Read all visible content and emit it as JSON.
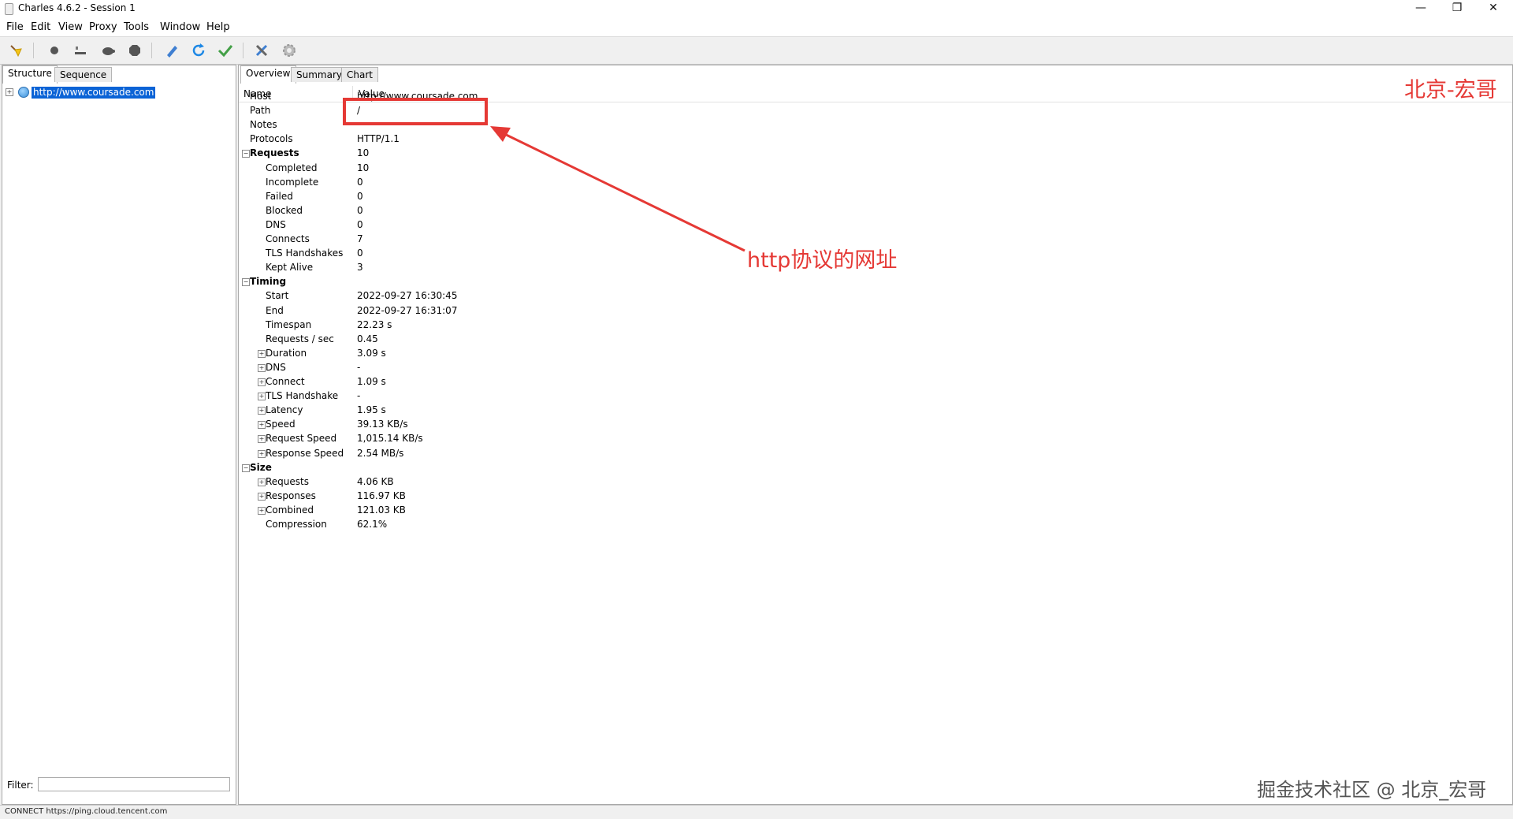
{
  "window": {
    "title": "Charles 4.6.2 - Session 1",
    "controls": [
      "—",
      "❐",
      "✕"
    ]
  },
  "menu": [
    "File",
    "Edit",
    "View",
    "Proxy",
    "Tools",
    "Window",
    "Help"
  ],
  "toolbar": {
    "icons": [
      "broom-icon",
      "record-icon",
      "throttle-icon",
      "turtle-icon",
      "stop-icon",
      "pen-icon",
      "refresh-icon",
      "check-icon",
      "tools-icon",
      "settings-icon"
    ]
  },
  "left": {
    "tabs": [
      "Structure",
      "Sequence"
    ],
    "tree": {
      "expander": "+",
      "host": "http://www.coursade.com"
    },
    "filter_label": "Filter:",
    "filter_value": ""
  },
  "right": {
    "tabs": [
      "Overview",
      "Summary",
      "Chart"
    ],
    "columns": {
      "name": "Name",
      "value": "Value"
    },
    "rows": [
      {
        "name": "Host",
        "value": "http://www.coursade.com"
      },
      {
        "name": "Path",
        "value": "/"
      },
      {
        "name": "Notes",
        "value": ""
      },
      {
        "name": "Protocols",
        "value": "HTTP/1.1"
      },
      {
        "name": "Requests",
        "value": "10"
      },
      {
        "name": "Completed",
        "value": "10"
      },
      {
        "name": "Incomplete",
        "value": "0"
      },
      {
        "name": "Failed",
        "value": "0"
      },
      {
        "name": "Blocked",
        "value": "0"
      },
      {
        "name": "DNS",
        "value": "0"
      },
      {
        "name": "Connects",
        "value": "7"
      },
      {
        "name": "TLS Handshakes",
        "value": "0"
      },
      {
        "name": "Kept Alive",
        "value": "3"
      },
      {
        "name": "Timing",
        "value": ""
      },
      {
        "name": "Start",
        "value": "2022-09-27 16:30:45"
      },
      {
        "name": "End",
        "value": "2022-09-27 16:31:07"
      },
      {
        "name": "Timespan",
        "value": "22.23 s"
      },
      {
        "name": "Requests / sec",
        "value": "0.45"
      },
      {
        "name": "Duration",
        "value": "3.09 s"
      },
      {
        "name": "DNS",
        "value": "-"
      },
      {
        "name": "Connect",
        "value": "1.09 s"
      },
      {
        "name": "TLS Handshake",
        "value": "-"
      },
      {
        "name": "Latency",
        "value": "1.95 s"
      },
      {
        "name": "Speed",
        "value": "39.13 KB/s"
      },
      {
        "name": "Request Speed",
        "value": "1,015.14 KB/s"
      },
      {
        "name": "Response Speed",
        "value": "2.54 MB/s"
      },
      {
        "name": "Size",
        "value": ""
      },
      {
        "name": "Requests",
        "value": "4.06 KB"
      },
      {
        "name": "Responses",
        "value": "116.97 KB"
      },
      {
        "name": "Combined",
        "value": "121.03 KB"
      },
      {
        "name": "Compression",
        "value": "62.1%"
      }
    ]
  },
  "annotation": {
    "text": "http协议的网址",
    "color": "#e53935"
  },
  "watermark": {
    "top": "北京-宏哥",
    "bottom": "掘金技术社区 @ 北京_宏哥"
  },
  "status": "CONNECT https://ping.cloud.tencent.com"
}
